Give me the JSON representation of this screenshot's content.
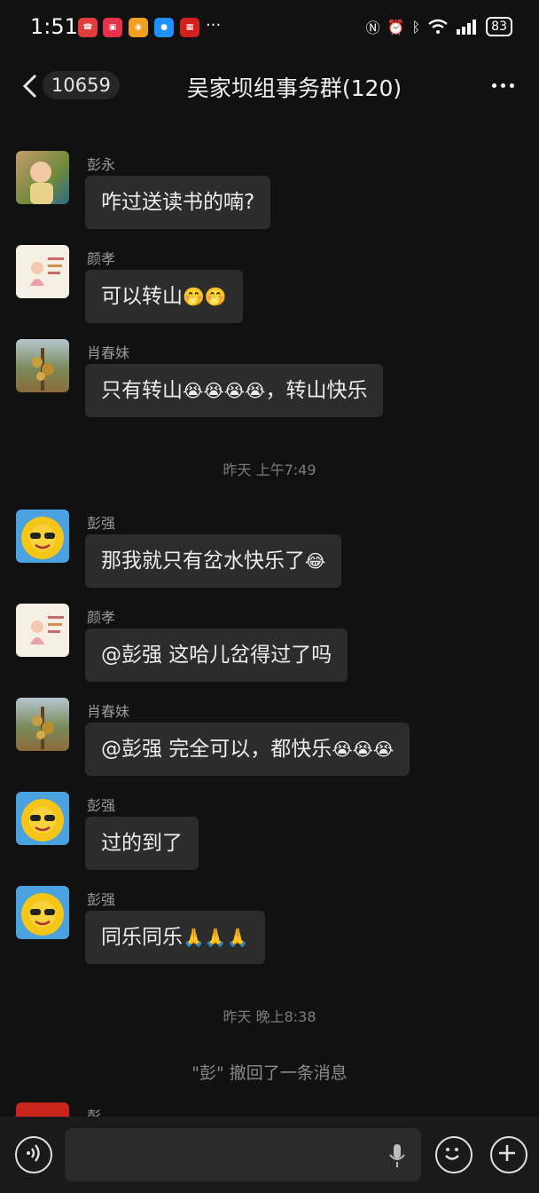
{
  "status_bar": {
    "time": "1:51",
    "overflow": "···",
    "battery": "83",
    "apps": [
      "phone-app-icon",
      "bank-app-icon",
      "weibo-app-icon",
      "chat-app-icon",
      "agri-bank-app-icon"
    ]
  },
  "header": {
    "unread_count": "10659",
    "title": "吴家坝组事务群(120)"
  },
  "messages": [
    {
      "sender": "彭永",
      "text": "咋过送读书的喃?"
    },
    {
      "sender": "颜孝",
      "text": "可以转山",
      "emoji": "🤭🤭"
    },
    {
      "sender": "肖春妹",
      "text": "只有转山",
      "emoji": "😭😭😭😭",
      "suffix": "，转山快乐"
    },
    {
      "sender": "彭强",
      "text": "那我就只有岔水快乐了",
      "emoji": "😂"
    },
    {
      "sender": "颜孝",
      "text": "@彭强  这哈儿岔得过了吗"
    },
    {
      "sender": "肖春妹",
      "text": "@彭强  完全可以，都快乐",
      "emoji": "😭😭😭"
    },
    {
      "sender": "彭强",
      "text": "过的到了"
    },
    {
      "sender": "彭强",
      "text": "同乐同乐",
      "emoji": "🙏🙏🙏"
    },
    {
      "sender": "彭"
    }
  ],
  "timestamps": [
    "昨天 上午7:49",
    "昨天 晚上8:38"
  ],
  "system_message": "\"彭\" 撤回了一条消息",
  "colors": {
    "background": "#111111",
    "bubble": "#2c2c2c"
  }
}
